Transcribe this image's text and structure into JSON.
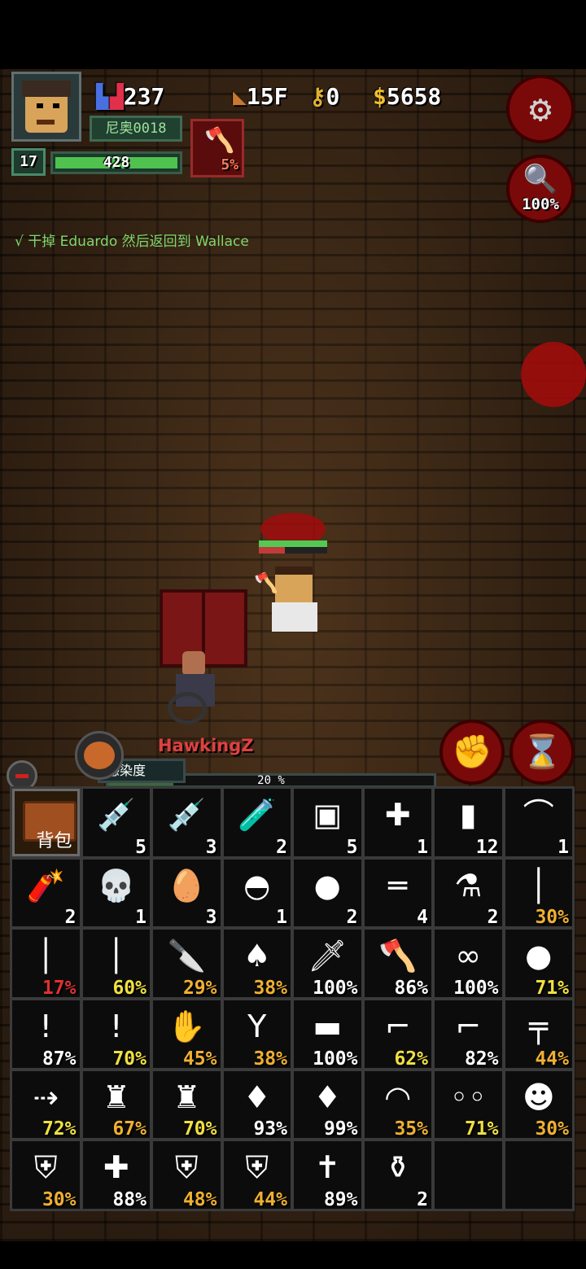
{
  "hud": {
    "population": "237",
    "floor": "15F",
    "keys": "0",
    "money": "5658",
    "player_name": "尼奥0018",
    "level": "17",
    "hp": "428",
    "weapon_durability": "5%",
    "search_percent": "100%"
  },
  "quest": "√ 干掉 Eduardo 然后返回到 Wallace",
  "npc_name": "HawkingZ",
  "infection": {
    "label": "感染度",
    "value": "20 %",
    "fraction": 0.2
  },
  "inventory": {
    "bag_label": "背包",
    "cells": [
      {
        "icon": "syringe-large-icon",
        "glyph": "💉",
        "count": "5",
        "color": "#ffffff"
      },
      {
        "icon": "syringe-icon",
        "glyph": "💉",
        "count": "3",
        "color": "#ffffff"
      },
      {
        "icon": "vial-icon",
        "glyph": "🧪",
        "count": "2",
        "color": "#ffffff"
      },
      {
        "icon": "bandage-icon",
        "glyph": "▣",
        "count": "5",
        "color": "#ffffff"
      },
      {
        "icon": "medkit-icon",
        "glyph": "✚",
        "count": "1",
        "color": "#ffffff"
      },
      {
        "icon": "battery-icon",
        "glyph": "▮",
        "count": "12",
        "color": "#ffffff"
      },
      {
        "icon": "bear-trap-icon",
        "glyph": "⌒",
        "count": "1",
        "color": "#ffffff"
      },
      {
        "icon": "dynamite-icon",
        "glyph": "🧨",
        "count": "2",
        "color": "#ffffff"
      },
      {
        "icon": "skull-icon",
        "glyph": "💀",
        "count": "1",
        "color": "#ffffff"
      },
      {
        "icon": "egg-icon",
        "glyph": "🥚",
        "count": "3",
        "color": "#ffffff"
      },
      {
        "icon": "landmine-icon",
        "glyph": "◓",
        "count": "1",
        "color": "#ffffff"
      },
      {
        "icon": "grenade-icon",
        "glyph": "●",
        "count": "2",
        "color": "#ffffff"
      },
      {
        "icon": "dumbbell-icon",
        "glyph": "═",
        "count": "4",
        "color": "#ffffff"
      },
      {
        "icon": "flask-icon",
        "glyph": "⚗",
        "count": "2",
        "color": "#ffffff"
      },
      {
        "icon": "screwdriver-icon",
        "glyph": "│",
        "count": "30%",
        "color": "#f0b030"
      },
      {
        "icon": "screwdriver-icon",
        "glyph": "│",
        "count": "17%",
        "color": "#e03030"
      },
      {
        "icon": "screwdriver-icon",
        "glyph": "│",
        "count": "60%",
        "color": "#f0e040"
      },
      {
        "icon": "swiss-knife-icon",
        "glyph": "🔪",
        "count": "29%",
        "color": "#f0b030"
      },
      {
        "icon": "shovel-icon",
        "glyph": "♠",
        "count": "38%",
        "color": "#f0b030"
      },
      {
        "icon": "knife-icon",
        "glyph": "🗡",
        "count": "100%",
        "color": "#ffffff"
      },
      {
        "icon": "axe-icon",
        "glyph": "🪓",
        "count": "86%",
        "color": "#ffffff"
      },
      {
        "icon": "brass-knuckles-icon",
        "glyph": "∞",
        "count": "100%",
        "color": "#ffffff"
      },
      {
        "icon": "boxing-glove-icon",
        "glyph": "●",
        "count": "71%",
        "color": "#f0e040"
      },
      {
        "icon": "torch-icon",
        "glyph": "!",
        "count": "87%",
        "color": "#ffffff"
      },
      {
        "icon": "torch-icon",
        "glyph": "!",
        "count": "70%",
        "color": "#f0e040"
      },
      {
        "icon": "zombie-hand-icon",
        "glyph": "✋",
        "count": "45%",
        "color": "#f0b030"
      },
      {
        "icon": "slingshot-icon",
        "glyph": "Y",
        "count": "38%",
        "color": "#f0b030"
      },
      {
        "icon": "rocket-launcher-icon",
        "glyph": "▬",
        "count": "100%",
        "color": "#ffffff"
      },
      {
        "icon": "pistol-icon",
        "glyph": "⌐",
        "count": "62%",
        "color": "#f0e040"
      },
      {
        "icon": "pistol-icon",
        "glyph": "⌐",
        "count": "82%",
        "color": "#ffffff"
      },
      {
        "icon": "rifle-icon",
        "glyph": "╤",
        "count": "44%",
        "color": "#f0b030"
      },
      {
        "icon": "laser-gun-icon",
        "glyph": "⇢",
        "count": "72%",
        "color": "#f0e040"
      },
      {
        "icon": "fire-extinguisher-icon",
        "glyph": "♜",
        "count": "67%",
        "color": "#f0b030"
      },
      {
        "icon": "fire-extinguisher-icon",
        "glyph": "♜",
        "count": "70%",
        "color": "#f0e040"
      },
      {
        "icon": "body-armor-icon",
        "glyph": "♦",
        "count": "93%",
        "color": "#ffffff"
      },
      {
        "icon": "body-armor-icon",
        "glyph": "♦",
        "count": "99%",
        "color": "#ffffff"
      },
      {
        "icon": "nurse-cap-icon",
        "glyph": "◠",
        "count": "35%",
        "color": "#f0b030"
      },
      {
        "icon": "glasses-icon",
        "glyph": "◦◦",
        "count": "71%",
        "color": "#f0e040"
      },
      {
        "icon": "gas-mask-icon",
        "glyph": "☻",
        "count": "30%",
        "color": "#f0b030"
      },
      {
        "icon": "lab-coat-icon",
        "glyph": "⛨",
        "count": "30%",
        "color": "#f0b030"
      },
      {
        "icon": "first-aid-box-icon",
        "glyph": "✚",
        "count": "88%",
        "color": "#ffffff"
      },
      {
        "icon": "jacket-icon",
        "glyph": "⛨",
        "count": "48%",
        "color": "#f0b030"
      },
      {
        "icon": "jacket-icon",
        "glyph": "⛨",
        "count": "44%",
        "color": "#f0b030"
      },
      {
        "icon": "bible-icon",
        "glyph": "✝",
        "count": "89%",
        "color": "#ffffff"
      },
      {
        "icon": "potion-icon",
        "glyph": "⚱",
        "count": "2",
        "color": "#ffffff"
      },
      {
        "icon": "",
        "glyph": "",
        "count": "",
        "color": "#ffffff"
      },
      {
        "icon": "",
        "glyph": "",
        "count": "",
        "color": "#ffffff"
      }
    ]
  }
}
